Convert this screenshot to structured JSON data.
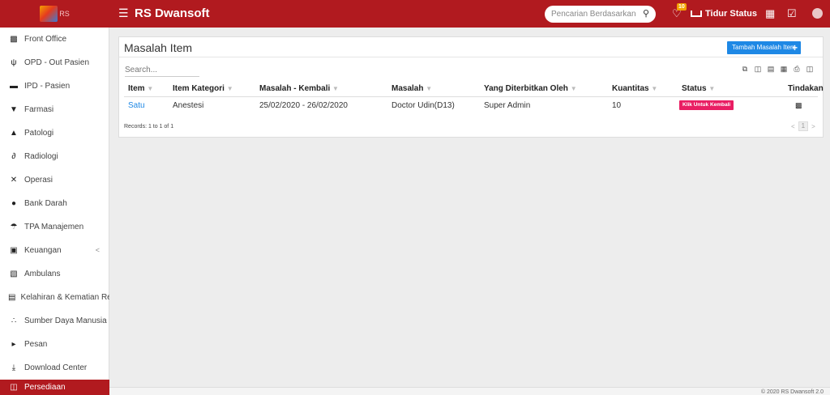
{
  "header": {
    "logo_text": "RS",
    "app_title": "RS Dwansoft",
    "search_placeholder": "Pencarian Berdasarkan",
    "notif_count": "10",
    "bed_status": "Tidur Status"
  },
  "sidebar": {
    "items": [
      {
        "label": "Front Office",
        "icon": "building-icon"
      },
      {
        "label": "OPD - Out Pasien",
        "icon": "stethoscope-icon"
      },
      {
        "label": "IPD - Pasien",
        "icon": "bed-icon"
      },
      {
        "label": "Farmasi",
        "icon": "mortar-icon"
      },
      {
        "label": "Patologi",
        "icon": "flask-icon"
      },
      {
        "label": "Radiologi",
        "icon": "xray-icon"
      },
      {
        "label": "Operasi",
        "icon": "scissors-icon"
      },
      {
        "label": "Bank Darah",
        "icon": "blood-drop-icon"
      },
      {
        "label": "TPA Manajemen",
        "icon": "umbrella-icon"
      },
      {
        "label": "Keuangan",
        "icon": "money-icon"
      },
      {
        "label": "Ambulans",
        "icon": "ambulance-icon"
      },
      {
        "label": "Kelahiran & Kematian Reco",
        "icon": "birthday-cake-icon"
      },
      {
        "label": "Sumber Daya Manusia",
        "icon": "sitemap-icon"
      },
      {
        "label": "Pesan",
        "icon": "bullhorn-icon"
      },
      {
        "label": "Download Center",
        "icon": "download-icon"
      },
      {
        "label": "Persediaan",
        "icon": "truck-loading-icon"
      }
    ]
  },
  "main": {
    "title": "Masalah Item",
    "add_button": "Tambah Masalah Item",
    "search_placeholder": "Search...",
    "columns": [
      "Item",
      "Item Kategori",
      "Masalah - Kembali",
      "Masalah",
      "Yang Diterbitkan Oleh",
      "Kuantitas",
      "Status",
      "Tindakan"
    ],
    "rows": [
      {
        "item": "Satu",
        "kategori": "Anestesi",
        "periode": "25/02/2020 - 26/02/2020",
        "masalah": "Doctor Udin(D13)",
        "oleh": "Super Admin",
        "kuantitas": "10",
        "status": "Klik Untuk Kembali"
      }
    ],
    "records": "Records: 1 to 1 of 1",
    "page": "1"
  },
  "footer": {
    "text": "© 2020 RS Dwansoft 2.0"
  },
  "colors": {
    "brand": "#b11a1f",
    "accent": "#1e88e5",
    "status": "#e91e63"
  }
}
